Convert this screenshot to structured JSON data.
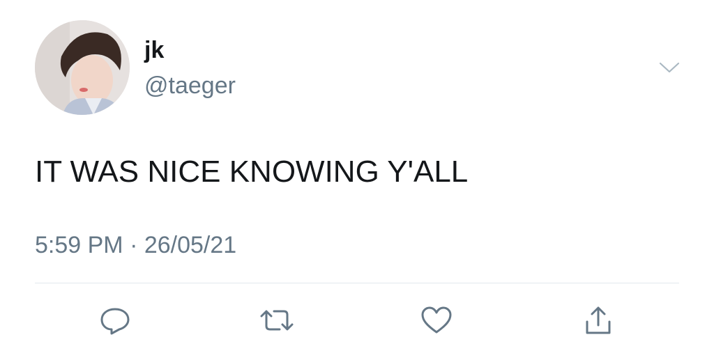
{
  "tweet": {
    "display_name": "jk",
    "handle": "@taeger",
    "text": "IT WAS NICE KNOWING Y'ALL",
    "time": "5:59 PM",
    "separator": "·",
    "date": "26/05/21",
    "timestamp": "5:59 PM · 26/05/21"
  },
  "actions": {
    "icons": [
      "reply-icon",
      "retweet-icon",
      "like-icon",
      "share-icon"
    ]
  },
  "colors": {
    "text": "#14171a",
    "secondary": "#657786",
    "divider": "#e1e8ed",
    "icon": "#657786"
  }
}
